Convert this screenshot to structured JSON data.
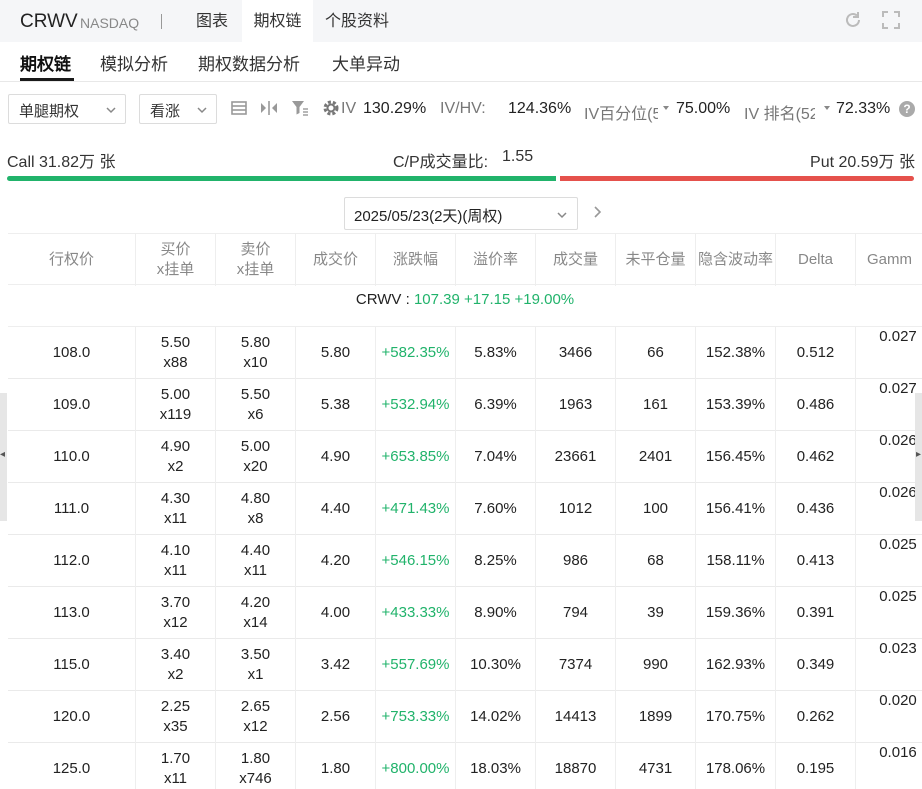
{
  "header": {
    "ticker": "CRWV",
    "exchange": "NASDAQ",
    "tabs": [
      {
        "label": "图表"
      },
      {
        "label": "期权链",
        "active": true
      },
      {
        "label": "个股资料"
      }
    ],
    "icons": [
      "refresh-icon",
      "fullscreen-icon"
    ]
  },
  "subtabs": [
    {
      "label": "期权链",
      "active": true
    },
    {
      "label": "模拟分析"
    },
    {
      "label": "期权数据分析"
    },
    {
      "label": "大单异动"
    }
  ],
  "filters": {
    "type_select": "单腿期权",
    "direction_select": "看涨",
    "iv_label": "IV",
    "iv_value": "130.29%",
    "ivhv_label": "IV/HV:",
    "ivhv_value": "124.36%",
    "iv_pct_label": "IV百分位(5",
    "iv_pct_value": "75.00%",
    "iv_rank_label": "IV 排名(52",
    "iv_rank_value": "72.33%",
    "help": "?"
  },
  "call_put": {
    "call_label": "Call 31.82万 张",
    "ratio_label": "C/P成交量比:",
    "ratio_value": "1.55",
    "put_label": "Put 20.59万 张",
    "call_share": 0.607
  },
  "expiry": {
    "selected": "2025/05/23(2天)(周权)"
  },
  "table": {
    "headers": [
      {
        "l1": "行权价",
        "l2": ""
      },
      {
        "l1": "买价",
        "l2": "x挂单"
      },
      {
        "l1": "卖价",
        "l2": "x挂单"
      },
      {
        "l1": "成交价",
        "l2": ""
      },
      {
        "l1": "涨跌幅",
        "l2": ""
      },
      {
        "l1": "溢价率",
        "l2": ""
      },
      {
        "l1": "成交量",
        "l2": ""
      },
      {
        "l1": "未平仓量",
        "l2": ""
      },
      {
        "l1": "隐含波动率",
        "l2": ""
      },
      {
        "l1": "Delta",
        "l2": ""
      },
      {
        "l1": "Gamm",
        "l2": ""
      }
    ],
    "underlying": {
      "symbol": "CRWV :",
      "price": "107.39",
      "change": "+17.15",
      "change_pct": "+19.00%"
    },
    "rows": [
      {
        "strike": "108.0",
        "bid": "5.50",
        "bid_size": "x88",
        "ask": "5.80",
        "ask_size": "x10",
        "last": "5.80",
        "chg": "+582.35%",
        "premium": "5.83%",
        "volume": "3466",
        "oi": "66",
        "iv": "152.38%",
        "delta": "0.512",
        "gamma": "0.027"
      },
      {
        "strike": "109.0",
        "bid": "5.00",
        "bid_size": "x119",
        "ask": "5.50",
        "ask_size": "x6",
        "last": "5.38",
        "chg": "+532.94%",
        "premium": "6.39%",
        "volume": "1963",
        "oi": "161",
        "iv": "153.39%",
        "delta": "0.486",
        "gamma": "0.027"
      },
      {
        "strike": "110.0",
        "bid": "4.90",
        "bid_size": "x2",
        "ask": "5.00",
        "ask_size": "x20",
        "last": "4.90",
        "chg": "+653.85%",
        "premium": "7.04%",
        "volume": "23661",
        "oi": "2401",
        "iv": "156.45%",
        "delta": "0.462",
        "gamma": "0.026"
      },
      {
        "strike": "111.0",
        "bid": "4.30",
        "bid_size": "x11",
        "ask": "4.80",
        "ask_size": "x8",
        "last": "4.40",
        "chg": "+471.43%",
        "premium": "7.60%",
        "volume": "1012",
        "oi": "100",
        "iv": "156.41%",
        "delta": "0.436",
        "gamma": "0.026"
      },
      {
        "strike": "112.0",
        "bid": "4.10",
        "bid_size": "x11",
        "ask": "4.40",
        "ask_size": "x11",
        "last": "4.20",
        "chg": "+546.15%",
        "premium": "8.25%",
        "volume": "986",
        "oi": "68",
        "iv": "158.11%",
        "delta": "0.413",
        "gamma": "0.025"
      },
      {
        "strike": "113.0",
        "bid": "3.70",
        "bid_size": "x12",
        "ask": "4.20",
        "ask_size": "x14",
        "last": "4.00",
        "chg": "+433.33%",
        "premium": "8.90%",
        "volume": "794",
        "oi": "39",
        "iv": "159.36%",
        "delta": "0.391",
        "gamma": "0.025"
      },
      {
        "strike": "115.0",
        "bid": "3.40",
        "bid_size": "x2",
        "ask": "3.50",
        "ask_size": "x1",
        "last": "3.42",
        "chg": "+557.69%",
        "premium": "10.30%",
        "volume": "7374",
        "oi": "990",
        "iv": "162.93%",
        "delta": "0.349",
        "gamma": "0.023"
      },
      {
        "strike": "120.0",
        "bid": "2.25",
        "bid_size": "x35",
        "ask": "2.65",
        "ask_size": "x12",
        "last": "2.56",
        "chg": "+753.33%",
        "premium": "14.02%",
        "volume": "14413",
        "oi": "1899",
        "iv": "170.75%",
        "delta": "0.262",
        "gamma": "0.020"
      },
      {
        "strike": "125.0",
        "bid": "1.70",
        "bid_size": "x11",
        "ask": "1.80",
        "ask_size": "x746",
        "last": "1.80",
        "chg": "+800.00%",
        "premium": "18.03%",
        "volume": "18870",
        "oi": "4731",
        "iv": "178.06%",
        "delta": "0.195",
        "gamma": "0.016"
      }
    ]
  },
  "colors": {
    "up": "#21b36b",
    "down": "#e5514c"
  }
}
